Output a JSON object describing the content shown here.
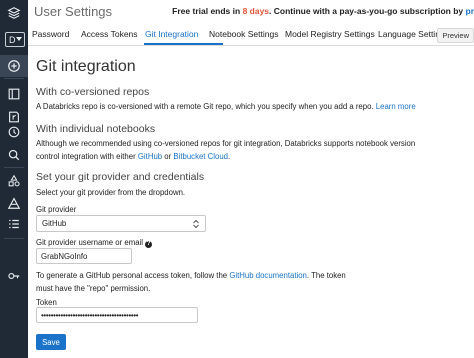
{
  "header": {
    "title": "User Settings",
    "trial_prefix": "Free trial ends in ",
    "trial_days": "8 days",
    "trial_suffix": ". Continue with a pay-as-you-go subscription by ",
    "trial_link": "pr"
  },
  "sidebar": {
    "workspace_selector": "D",
    "items": [
      {
        "icon": "layers-icon"
      },
      {
        "icon": "plus-icon"
      },
      {
        "icon": "workspace-icon"
      },
      {
        "icon": "repos-icon"
      },
      {
        "icon": "recents-icon"
      },
      {
        "icon": "search-icon"
      },
      {
        "icon": "shapes-icon"
      },
      {
        "icon": "datasets-icon"
      },
      {
        "icon": "jobs-icon"
      },
      {
        "icon": "key-icon"
      }
    ]
  },
  "tabs": [
    {
      "label": "Password"
    },
    {
      "label": "Access Tokens"
    },
    {
      "label": "Git Integration"
    },
    {
      "label": "Notebook Settings"
    },
    {
      "label": "Model Registry Settings"
    },
    {
      "label": "Language Settings"
    },
    {
      "label": "Preview"
    }
  ],
  "main": {
    "title": "Git integration",
    "section_coversioned": {
      "heading": "With co-versioned repos",
      "text": "A Databricks repo is co-versioned with a remote Git repo, which you specify when you add a repo.",
      "link": "Learn more"
    },
    "section_notebooks": {
      "heading": "With individual notebooks",
      "line1": "Although we recommended using co-versioned repos for git integration, Databricks supports notebook version",
      "line2_prefix": "control integration with either ",
      "github_link": "GitHub",
      "or": " or ",
      "bitbucket_link": "Bitbucket Cloud",
      "period": "."
    },
    "section_provider": {
      "heading": "Set your git provider and credentials",
      "instructions": "Select your git provider from the dropdown.",
      "provider_label": "Git provider",
      "provider_value": "GitHub",
      "username_label": "Git provider username or email",
      "username_value": "GrabNGoInfo",
      "token_line1_prefix": "To generate a GitHub personal access token, follow the ",
      "token_doc_link": "GitHub documentation",
      "token_line1_suffix": ". The token",
      "token_line2": "must have the \"repo\" permission.",
      "token_label": "Token",
      "token_value": "••••••••••••••••••••••••••••••••••••••••",
      "save_label": "Save"
    }
  },
  "colors": {
    "sidebar_bg": "#1f2a36",
    "accent": "#1a73c8",
    "trial_days": "#e0553b"
  }
}
